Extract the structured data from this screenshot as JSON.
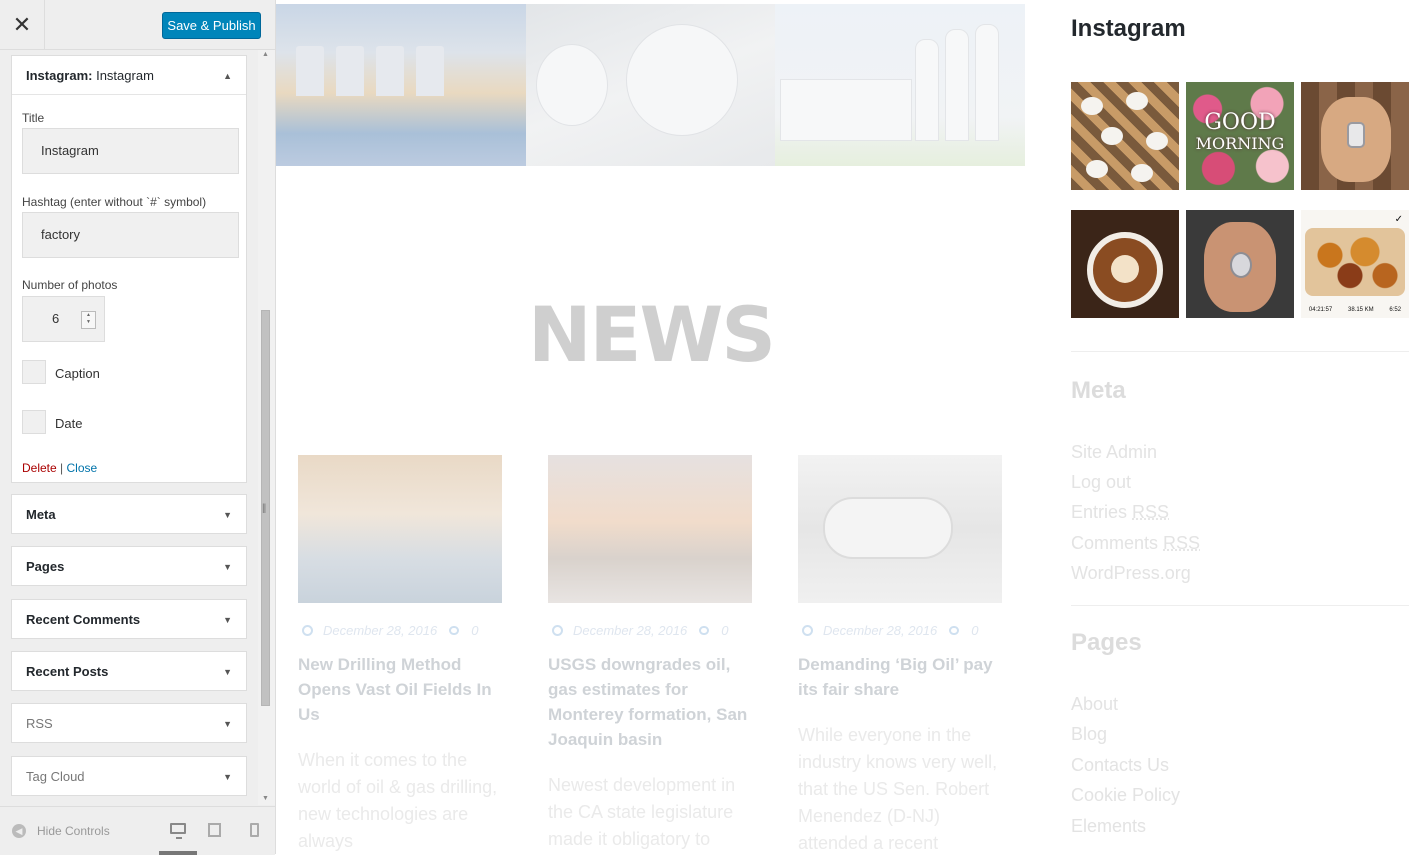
{
  "header": {
    "close_icon": "close-icon",
    "publish_label": "Save & Publish"
  },
  "instagram_widget": {
    "title_prefix": "Instagram:",
    "title_name": "Instagram",
    "title_label": "Title",
    "title_value": "Instagram",
    "hashtag_label": "Hashtag (enter without `#` symbol)",
    "hashtag_value": "factory",
    "photos_label": "Number of photos",
    "photos_value": "6",
    "caption_label": "Caption",
    "date_label": "Date",
    "delete_label": "Delete",
    "separator": "|",
    "close_label": "Close"
  },
  "widgets": [
    {
      "label": "Meta"
    },
    {
      "label": "Pages"
    },
    {
      "label": "Recent Comments"
    },
    {
      "label": "Recent Posts"
    },
    {
      "label": "RSS"
    },
    {
      "label": "Tag Cloud"
    }
  ],
  "footer": {
    "hide_controls": "Hide Controls",
    "active_device": "desktop"
  },
  "preview": {
    "news_title": "NEWS",
    "posts": [
      {
        "date": "December 28, 2016",
        "comments": "0",
        "title": "New Drilling Method Opens Vast Oil Fields In Us",
        "excerpt": "When it comes to the world of oil & gas drilling, new technologies are always"
      },
      {
        "date": "December 28, 2016",
        "comments": "0",
        "title": "USGS downgrades oil, gas estimates for Monterey formation, San Joaquin basin",
        "excerpt": "Newest development in the CA state legislature made it obligatory to"
      },
      {
        "date": "December 28, 2016",
        "comments": "0",
        "title": "Demanding ‘Big Oil’ pay its fair share",
        "excerpt": "While everyone in the industry knows very well, that the US Sen. Robert Menendez (D-NJ) attended a recent"
      }
    ],
    "sidebar": {
      "instagram_title": "Instagram",
      "ig2_line1": "GOOD",
      "ig2_line2": "MORNING",
      "ig6_stats": [
        "04:21:57",
        "38.15 KM",
        "6:52"
      ],
      "meta_title": "Meta",
      "meta_links": [
        "Site Admin",
        "Log out",
        "Entries ",
        "Comments "
      ],
      "rss_abbr": "RSS",
      "wordpress_link": "WordPress.org",
      "pages_title": "Pages",
      "pages_links": [
        "About",
        "Blog",
        "Contacts Us",
        "Cookie Policy",
        "Elements"
      ]
    }
  }
}
